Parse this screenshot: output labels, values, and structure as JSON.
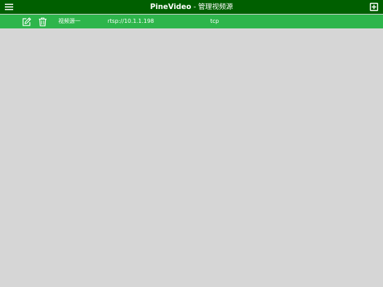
{
  "header": {
    "brand": "PineVideo",
    "separator": " - ",
    "subtitle": "管理视频源",
    "menu_icon": "hamburger-menu-icon",
    "add_icon": "add-square-icon"
  },
  "sources": [
    {
      "name": "视频源一",
      "url": "rtsp://10.1.1.198",
      "protocol": "tcp",
      "edit_icon": "edit-icon",
      "delete_icon": "trash-icon"
    }
  ],
  "colors": {
    "header_bg": "#005f00",
    "row_bg": "#2db54b",
    "page_bg": "#d6d6d6",
    "text": "#ffffff"
  }
}
